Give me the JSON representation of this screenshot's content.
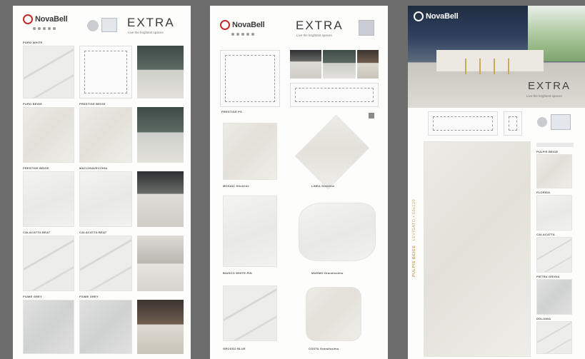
{
  "brand": "NovaBell",
  "collection": "EXTRA",
  "tagline": "Live the brightest spaces",
  "panel1": {
    "labels": [
      "PURO WHITE",
      "PURO BEIGE",
      "PRESTIGE BEIGE",
      "MACCHIAVECCHIA",
      "CALACATTA BEAT",
      "CALACATTA BEAT",
      "FIUME GREY",
      "FIUME GREY"
    ]
  },
  "panel2": {
    "labels": [
      "PRESTIGE PS",
      "MOSAIC Stickline",
      "LINEA Stickline",
      "BIANCO WHITE PIN",
      "MARMO Grandissimo",
      "GROSSO BLUE",
      "COSTA Grandissimo"
    ]
  },
  "panel3": {
    "side_label": "PULPIS BEIGE",
    "side_sub": "LEVIGATO • 60x120",
    "samples": [
      "PULPIS BEIGE",
      "FLORIDA",
      "CALACATTA",
      "PIETRA GRIGIA",
      "DOLOMIA"
    ]
  }
}
